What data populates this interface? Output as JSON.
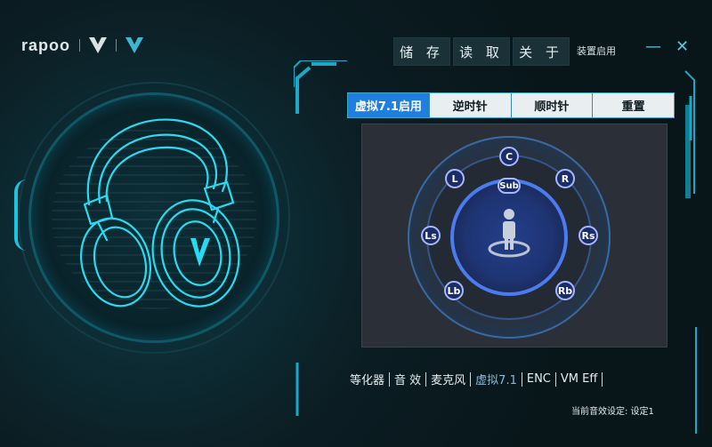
{
  "brand": {
    "name": "rapoo"
  },
  "toolbar": {
    "save_label": "储 存",
    "load_label": "读 取",
    "about_label": "关 于"
  },
  "device_status": "装置启用",
  "window": {
    "minimize_glyph": "—",
    "close_glyph": "✕"
  },
  "tabs": [
    {
      "label": "虚拟7.1启用",
      "active": true
    },
    {
      "label": "逆时针",
      "active": false
    },
    {
      "label": "顺时针",
      "active": false
    },
    {
      "label": "重置",
      "active": false
    }
  ],
  "speakers": {
    "c": "C",
    "l": "L",
    "r": "R",
    "sub": "Sub",
    "ls": "Ls",
    "rs": "Rs",
    "lb": "Lb",
    "rb": "Rb"
  },
  "bottom_nav": [
    {
      "label": "等化器",
      "active": false
    },
    {
      "label": "音 效",
      "active": false
    },
    {
      "label": "麦克风",
      "active": false
    },
    {
      "label": "虚拟7.1",
      "active": true
    },
    {
      "label": "ENC",
      "active": false
    },
    {
      "label": "VM Eff",
      "active": false
    }
  ],
  "status_line": "当前音效设定: 设定1",
  "colors": {
    "accent": "#1ec3de",
    "tab_active": "#1e7fe0",
    "ring": "#3b6fd8"
  }
}
